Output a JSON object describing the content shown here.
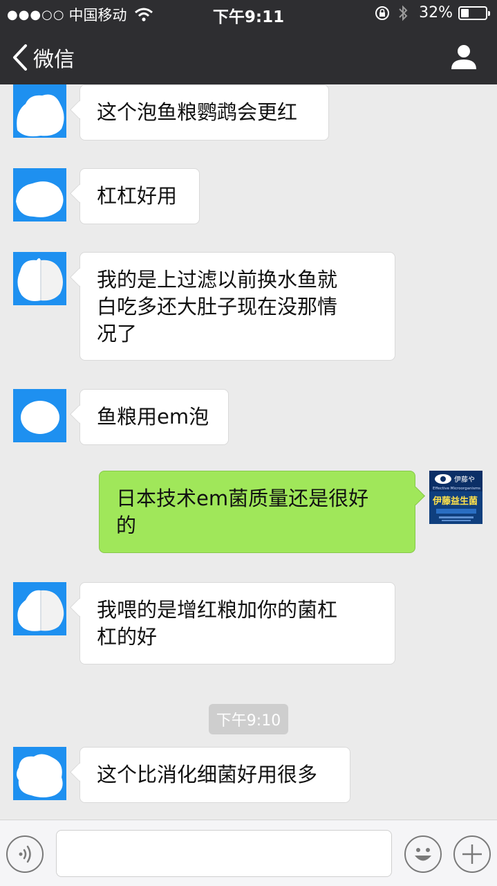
{
  "status_bar": {
    "signal": "●●●○○",
    "carrier": "中国移动",
    "time": "下午9:11",
    "battery_text": "32%",
    "battery_level": 0.32
  },
  "nav": {
    "back_label": "微信",
    "contact_icon": "person-icon"
  },
  "messages": [
    {
      "side": "left",
      "text": "这个泡鱼粮鹦鹉会更红",
      "lines": [
        "这个泡鱼粮鹦鹉会更红"
      ]
    },
    {
      "side": "left",
      "text": "杠杠好用",
      "lines": [
        "杠杠好用"
      ]
    },
    {
      "side": "left",
      "text": "我的是上过滤以前换水鱼就白吃多还大肚子现在没那情况了",
      "lines": [
        "我的是上过滤以前换水鱼就",
        "白吃多还大肚子现在没那情",
        "况了"
      ]
    },
    {
      "side": "left",
      "text": "鱼粮用em泡",
      "lines": [
        "鱼粮用em泡"
      ]
    },
    {
      "side": "right",
      "text": "日本技术em菌质量还是很好的",
      "lines": [
        "日本技术em菌质量还是很好",
        "的"
      ]
    },
    {
      "side": "left",
      "text": "我喂的是增红粮加你的菌杠杠的好",
      "lines": [
        "我喂的是增红粮加你的菌杠",
        "杠的好"
      ]
    },
    {
      "side": "left",
      "text": "这个比消化细菌好用很多",
      "lines": [
        "这个比消化细菌好用很多"
      ]
    }
  ],
  "timestamp": "下午9:10",
  "my_avatar": {
    "brand": "伊藤や",
    "product": "伊藤益生菌",
    "subtitle": "Effective Microorganisms"
  },
  "colors": {
    "navbar": "#2e2e31",
    "chat_bg": "#ebebeb",
    "sent_bubble": "#a0e75a",
    "received_bubble": "#ffffff",
    "avatar_blue": "#1e90f0"
  },
  "input_bar": {
    "voice_icon": "voice-icon",
    "emoji_icon": "emoji-icon",
    "plus_icon": "plus-icon",
    "placeholder": ""
  }
}
